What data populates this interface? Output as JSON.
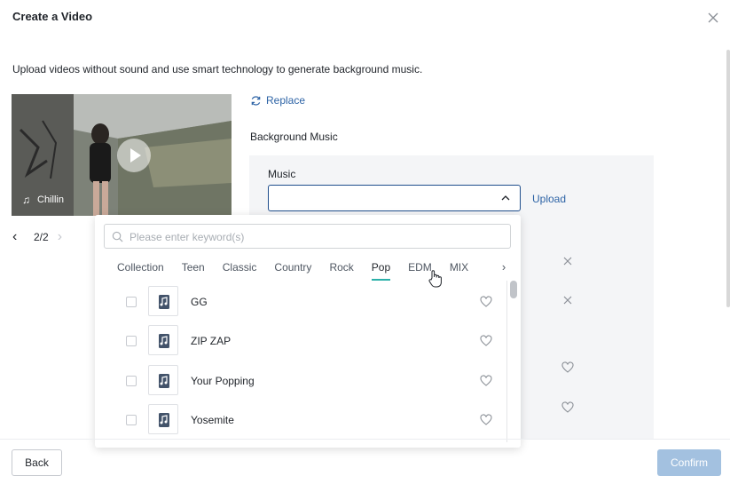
{
  "dialog": {
    "title": "Create a Video",
    "subtitle": "Upload videos without sound and use smart technology to generate background music."
  },
  "video": {
    "music_name": "Chillin",
    "pager": {
      "current": "2/2"
    }
  },
  "replace_label": "Replace",
  "background_music_label": "Background Music",
  "music": {
    "label": "Music",
    "value": "",
    "upload_label": "Upload"
  },
  "dropdown": {
    "search_placeholder": "Please enter keyword(s)",
    "tabs": [
      {
        "label": "Collection"
      },
      {
        "label": "Teen"
      },
      {
        "label": "Classic"
      },
      {
        "label": "Country"
      },
      {
        "label": "Rock"
      },
      {
        "label": "Pop"
      },
      {
        "label": "EDM"
      },
      {
        "label": "MIX"
      }
    ],
    "active_tab": "Pop",
    "tracks": [
      {
        "name": "GG"
      },
      {
        "name": "ZIP ZAP"
      },
      {
        "name": "Your Popping"
      },
      {
        "name": "Yosemite"
      }
    ]
  },
  "footer": {
    "back_label": "Back",
    "confirm_label": "Confirm"
  },
  "colors": {
    "link": "#2e64a6",
    "active_tab_underline": "#2bb0a9",
    "confirm_disabled": "#a3c1e0",
    "select_border": "#1f4e8c"
  },
  "icons": {
    "close": "close-icon",
    "replace": "refresh-icon",
    "music_note": "music-note-icon",
    "play": "play-icon",
    "search": "search-icon",
    "heart": "heart-icon",
    "track_thumb": "music-file-icon"
  }
}
